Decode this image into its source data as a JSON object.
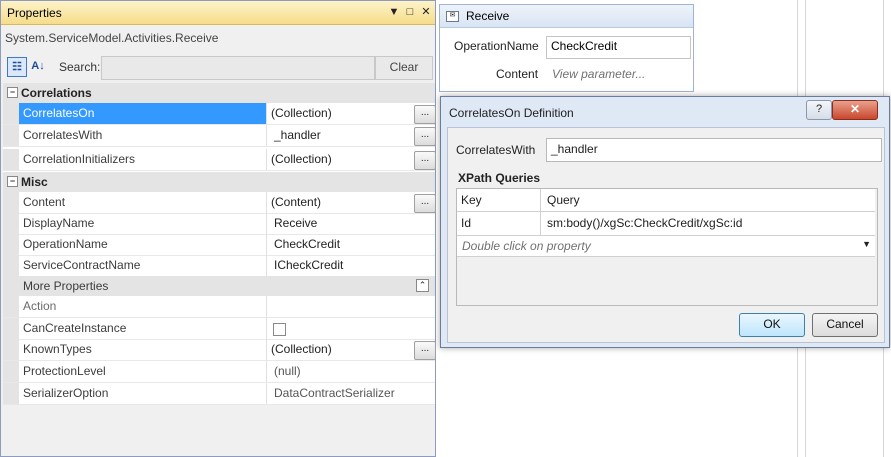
{
  "properties": {
    "title": "Properties",
    "subtitle": "System.ServiceModel.Activities.Receive",
    "search_label": "Search:",
    "clear_label": "Clear",
    "categories": [
      {
        "label": "Correlations",
        "expander": "−"
      },
      {
        "label": "Misc",
        "expander": "−"
      }
    ],
    "correlations": [
      {
        "name": "CorrelatesOn",
        "value": "(Collection)"
      },
      {
        "name": "CorrelatesWith",
        "value": "_handler"
      },
      {
        "name": "CorrelationInitializers",
        "value": "(Collection)"
      }
    ],
    "misc": [
      {
        "name": "Content",
        "value": "(Content)"
      },
      {
        "name": "DisplayName",
        "value": "Receive"
      },
      {
        "name": "OperationName",
        "value": "CheckCredit"
      },
      {
        "name": "ServiceContractName",
        "value": "ICheckCredit"
      }
    ],
    "more_label": "More Properties",
    "more": [
      {
        "name": "Action",
        "value": ""
      },
      {
        "name": "CanCreateInstance",
        "value": ""
      },
      {
        "name": "KnownTypes",
        "value": "(Collection)"
      },
      {
        "name": "ProtectionLevel",
        "value": "(null)"
      },
      {
        "name": "SerializerOption",
        "value": "DataContractSerializer"
      }
    ],
    "ellipsis": "..."
  },
  "receive": {
    "title": "Receive",
    "operation_label": "OperationName",
    "operation_value": "CheckCredit",
    "content_label": "Content",
    "content_link": "View parameter..."
  },
  "dialog": {
    "title": "CorrelatesOn Definition",
    "help": "?",
    "close": "✕",
    "correlates_with_label": "CorrelatesWith",
    "correlates_with_value": "_handler",
    "xpath_title": "XPath Queries",
    "columns": [
      "Key",
      "Query"
    ],
    "rows": [
      {
        "key": "Id",
        "query": "sm:body()/xgSc:CheckCredit/xgSc:id"
      }
    ],
    "new_row_placeholder": "Double click on property",
    "ok": "OK",
    "cancel": "Cancel"
  }
}
